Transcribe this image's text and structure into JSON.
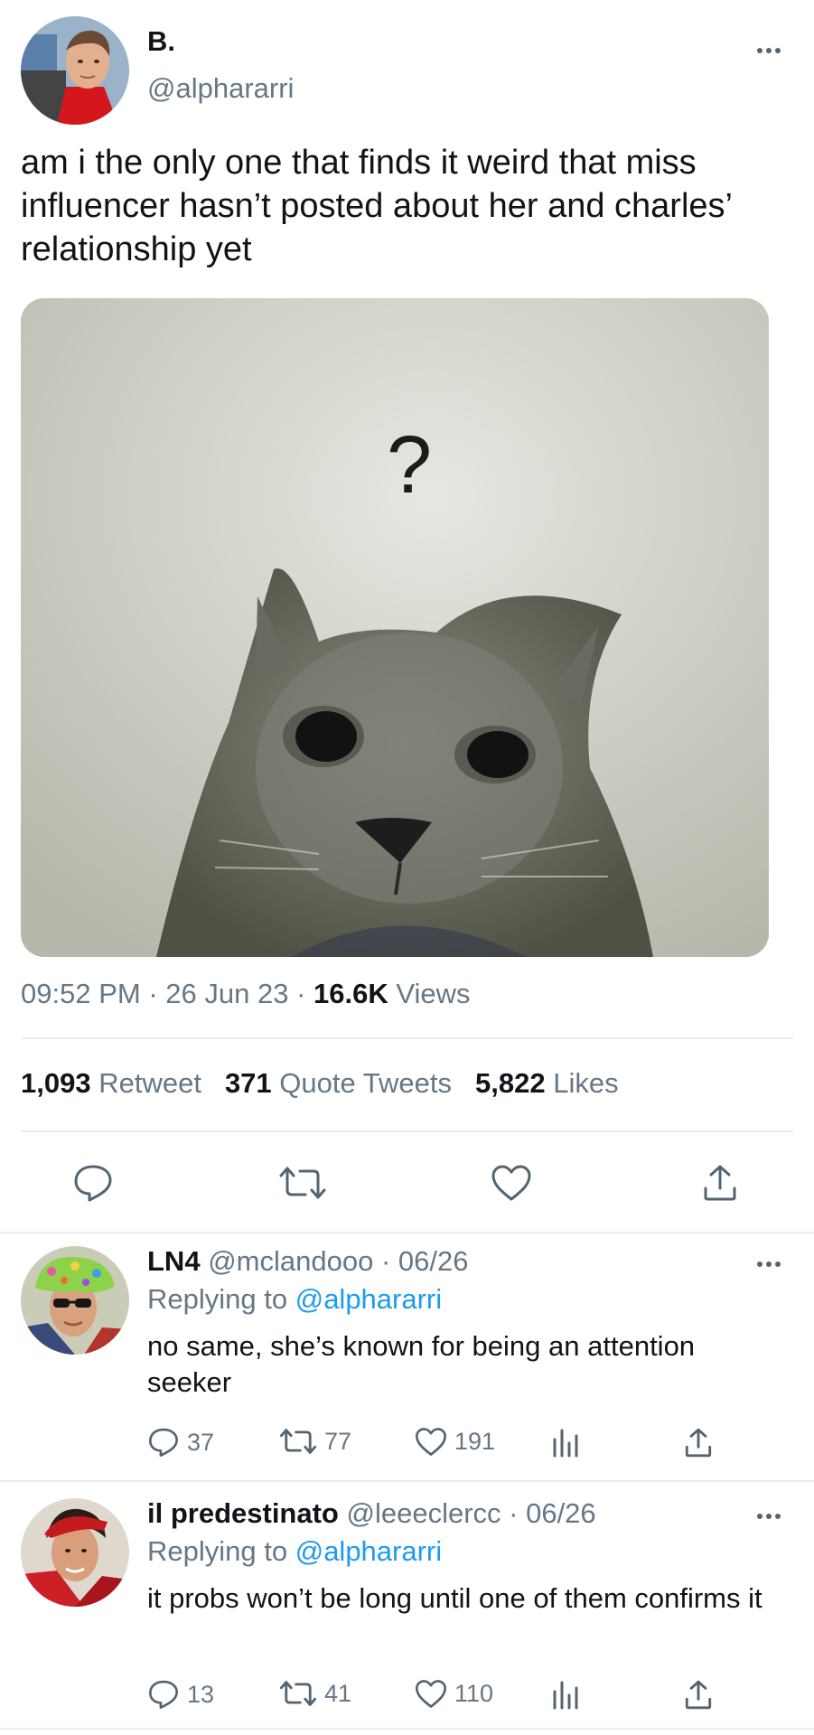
{
  "tweet": {
    "author_name": "B.",
    "author_handle": "@alphararri",
    "text": "am i the only one that finds it weird that miss influencer hasn’t posted about her and charles’ relationship yet",
    "media_question_mark": "?",
    "time": "09:52 PM",
    "date": "26 Jun 23",
    "separator": "·",
    "views_count": "16.6K",
    "views_label": "Views",
    "retweets_count": "1,093",
    "retweets_label": "Retweet",
    "quotes_count": "371",
    "quotes_label": "Quote Tweets",
    "likes_count": "5,822",
    "likes_label": "Likes"
  },
  "replies": [
    {
      "name": "LN4",
      "handle": "@mclandooo",
      "date": "· 06/26",
      "replying_prefix": "Replying to",
      "replying_to": "@alphararri",
      "text": "no same, she’s known for being an attention seeker",
      "comments": "37",
      "retweets": "77",
      "likes": "191"
    },
    {
      "name": "il predestinato",
      "handle": "@leeeclercc",
      "date": "· 06/26",
      "replying_prefix": "Replying to",
      "replying_to": "@alphararri",
      "text": "it probs won’t be long until one of them confirms it",
      "comments": "13",
      "retweets": "41",
      "likes": "110"
    }
  ],
  "icons": {
    "more": "more-dots-icon",
    "reply": "speech-bubble-icon",
    "retweet": "retweet-arrows-icon",
    "like": "heart-icon",
    "share": "share-upload-icon",
    "analytics": "bar-chart-icon"
  },
  "colors": {
    "text": "#0f1419",
    "muted": "#657786",
    "link": "#1d9bf0",
    "divider": "#e6ecf0"
  }
}
